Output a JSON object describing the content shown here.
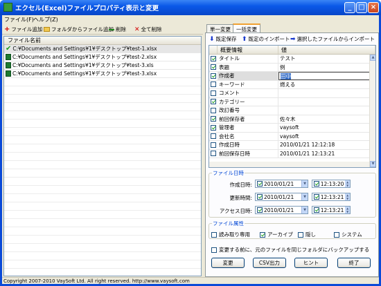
{
  "window": {
    "title": "エクセル(Excel)ファイルプロパティ表示と変更"
  },
  "menu": [
    "ファイル(F)",
    "ヘルプ(Z)"
  ],
  "toolbar": {
    "add_file": "ファイル追加",
    "add_from_folder": "フォルダからファイル追加",
    "delete": "削除",
    "delete_all": "全て削除"
  },
  "file_list": {
    "header": "ファイル名前",
    "files": [
      "C:¥Documents and Settings¥1¥デスクトップ¥test-1.xlsx",
      "C:¥Documents and Settings¥1¥デスクトップ¥test-2.xlsx",
      "C:¥Documents and Settings¥1¥デスクトップ¥test-3.xls",
      "C:¥Documents and Settings¥1¥デスクトップ¥test-3.xlsx"
    ]
  },
  "tabs": [
    "単一変更",
    "一括変更"
  ],
  "import_bar": {
    "save_settings": "既定保存",
    "import_settings": "既定のインポート",
    "import_from_file": "選択したファイルからインポート"
  },
  "grid": {
    "col_name": "概要情報",
    "col_value": "値",
    "rows": [
      {
        "name": "タイトル",
        "value": "テスト",
        "checked": true
      },
      {
        "name": "表題",
        "value": "例",
        "checked": true
      },
      {
        "name": "作成者",
        "value": "田中",
        "checked": true
      },
      {
        "name": "キーワード",
        "value": "燃える",
        "checked": false
      },
      {
        "name": "コメント",
        "value": "",
        "checked": false
      },
      {
        "name": "カテゴリー",
        "value": "",
        "checked": true
      },
      {
        "name": "改訂番号",
        "value": "",
        "checked": false
      },
      {
        "name": "前回保存者",
        "value": "佐々木",
        "checked": true
      },
      {
        "name": "管理者",
        "value": "vaysoft",
        "checked": true
      },
      {
        "name": "会社名",
        "value": "vaysoft",
        "checked": false
      },
      {
        "name": "作成日時",
        "value": "2010/01/21 12:12:18",
        "checked": false
      },
      {
        "name": "前回保存日時",
        "value": "2010/01/21 12:13:21",
        "checked": false
      }
    ]
  },
  "file_dates": {
    "legend": "ファイル日時",
    "rows": [
      {
        "label": "作成日時:",
        "date": "2010/01/21",
        "time": "12:13:20"
      },
      {
        "label": "更新時間:",
        "date": "2010/01/21",
        "time": "12:13:21"
      },
      {
        "label": "アクセス日時:",
        "date": "2010/01/21",
        "time": "12:13:21"
      }
    ]
  },
  "file_attributes": {
    "legend": "ファイル属性",
    "readonly": "読み取り専用",
    "archive": "アーカイブ",
    "hidden": "隠し",
    "system": "システム"
  },
  "backup_option": "変更する前に、元のファイルを同じフォルダにバックアップする",
  "buttons": {
    "change": "変更",
    "csv": "CSV出力",
    "hint": "ヒント",
    "exit": "終了"
  },
  "status": "Copyright 2007-2010 VaySoft Ltd. All right reserved. http://www.vaysoft.com"
}
